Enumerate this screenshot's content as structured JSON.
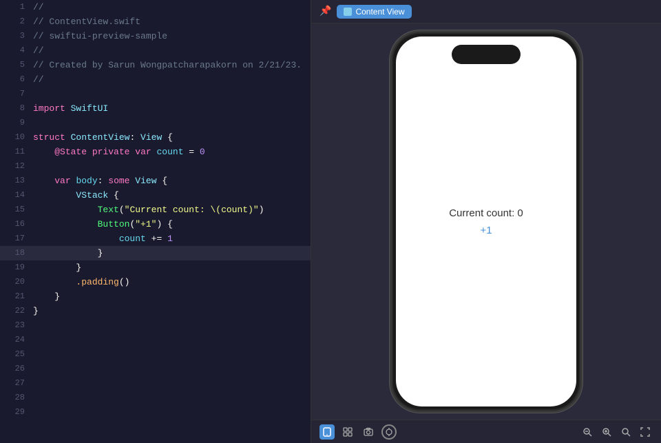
{
  "editor": {
    "lines": [
      {
        "num": 1,
        "tokens": [
          {
            "text": "//",
            "cls": "c-comment"
          }
        ]
      },
      {
        "num": 2,
        "tokens": [
          {
            "text": "// ContentView.swift",
            "cls": "c-comment"
          }
        ]
      },
      {
        "num": 3,
        "tokens": [
          {
            "text": "// swiftui-preview-sample",
            "cls": "c-comment"
          }
        ]
      },
      {
        "num": 4,
        "tokens": [
          {
            "text": "//",
            "cls": "c-comment"
          }
        ]
      },
      {
        "num": 5,
        "tokens": [
          {
            "text": "// Created by Sarun Wongpatcharapakorn on 2/21/23.",
            "cls": "c-comment"
          }
        ]
      },
      {
        "num": 6,
        "tokens": [
          {
            "text": "//",
            "cls": "c-comment"
          }
        ]
      },
      {
        "num": 7,
        "tokens": []
      },
      {
        "num": 8,
        "tokens": [
          {
            "text": "import ",
            "cls": "c-keyword"
          },
          {
            "text": "SwiftUI",
            "cls": "c-type"
          }
        ]
      },
      {
        "num": 9,
        "tokens": []
      },
      {
        "num": 10,
        "tokens": [
          {
            "text": "struct ",
            "cls": "c-keyword"
          },
          {
            "text": "ContentView",
            "cls": "c-type"
          },
          {
            "text": ": ",
            "cls": "c-white"
          },
          {
            "text": "View",
            "cls": "c-type"
          },
          {
            "text": " {",
            "cls": "c-white"
          }
        ]
      },
      {
        "num": 11,
        "tokens": [
          {
            "text": "    ",
            "cls": "c-white"
          },
          {
            "text": "@State",
            "cls": "c-attr"
          },
          {
            "text": " ",
            "cls": "c-white"
          },
          {
            "text": "private",
            "cls": "c-keyword"
          },
          {
            "text": " ",
            "cls": "c-white"
          },
          {
            "text": "var",
            "cls": "c-keyword"
          },
          {
            "text": " ",
            "cls": "c-white"
          },
          {
            "text": "count",
            "cls": "c-varname"
          },
          {
            "text": " = ",
            "cls": "c-white"
          },
          {
            "text": "0",
            "cls": "c-number"
          }
        ]
      },
      {
        "num": 12,
        "tokens": []
      },
      {
        "num": 13,
        "tokens": [
          {
            "text": "    ",
            "cls": "c-white"
          },
          {
            "text": "var",
            "cls": "c-keyword"
          },
          {
            "text": " ",
            "cls": "c-white"
          },
          {
            "text": "body",
            "cls": "c-varname"
          },
          {
            "text": ": ",
            "cls": "c-white"
          },
          {
            "text": "some",
            "cls": "c-keyword"
          },
          {
            "text": " ",
            "cls": "c-white"
          },
          {
            "text": "View",
            "cls": "c-type"
          },
          {
            "text": " {",
            "cls": "c-white"
          }
        ]
      },
      {
        "num": 14,
        "tokens": [
          {
            "text": "        ",
            "cls": "c-white"
          },
          {
            "text": "VStack",
            "cls": "c-type"
          },
          {
            "text": " {",
            "cls": "c-white"
          }
        ]
      },
      {
        "num": 15,
        "tokens": [
          {
            "text": "            ",
            "cls": "c-white"
          },
          {
            "text": "Text",
            "cls": "c-func"
          },
          {
            "text": "(",
            "cls": "c-white"
          },
          {
            "text": "\"Current count: \\(count)\"",
            "cls": "c-string"
          },
          {
            "text": ")",
            "cls": "c-white"
          }
        ]
      },
      {
        "num": 16,
        "tokens": [
          {
            "text": "            ",
            "cls": "c-white"
          },
          {
            "text": "Button",
            "cls": "c-func"
          },
          {
            "text": "(",
            "cls": "c-white"
          },
          {
            "text": "\"+1\"",
            "cls": "c-string"
          },
          {
            "text": ") {",
            "cls": "c-white"
          }
        ]
      },
      {
        "num": 17,
        "tokens": [
          {
            "text": "                ",
            "cls": "c-white"
          },
          {
            "text": "count",
            "cls": "c-varname"
          },
          {
            "text": " += ",
            "cls": "c-white"
          },
          {
            "text": "1",
            "cls": "c-number"
          }
        ]
      },
      {
        "num": 18,
        "tokens": [
          {
            "text": "            }",
            "cls": "c-white"
          }
        ],
        "active": true
      },
      {
        "num": 19,
        "tokens": [
          {
            "text": "        }",
            "cls": "c-white"
          }
        ]
      },
      {
        "num": 20,
        "tokens": [
          {
            "text": "        ",
            "cls": "c-white"
          },
          {
            "text": ".padding",
            "cls": "c-prop"
          },
          {
            "text": "()",
            "cls": "c-white"
          }
        ]
      },
      {
        "num": 21,
        "tokens": [
          {
            "text": "    }",
            "cls": "c-white"
          }
        ]
      },
      {
        "num": 22,
        "tokens": [
          {
            "text": "}",
            "cls": "c-white"
          }
        ]
      },
      {
        "num": 23,
        "tokens": []
      },
      {
        "num": 24,
        "tokens": []
      },
      {
        "num": 25,
        "tokens": []
      },
      {
        "num": 26,
        "tokens": []
      },
      {
        "num": 27,
        "tokens": []
      },
      {
        "num": 28,
        "tokens": []
      },
      {
        "num": 29,
        "tokens": []
      }
    ]
  },
  "preview": {
    "tab_label": "Content View",
    "phone_text": "Current count: 0",
    "phone_button": "+1"
  },
  "toolbar": {
    "bottom_left": [
      "device-icon",
      "grid-icon",
      "screenshot-icon",
      "settings-icon"
    ],
    "bottom_right": [
      "zoom-out-icon",
      "zoom-100-icon",
      "zoom-in-icon",
      "zoom-fit-icon"
    ]
  }
}
